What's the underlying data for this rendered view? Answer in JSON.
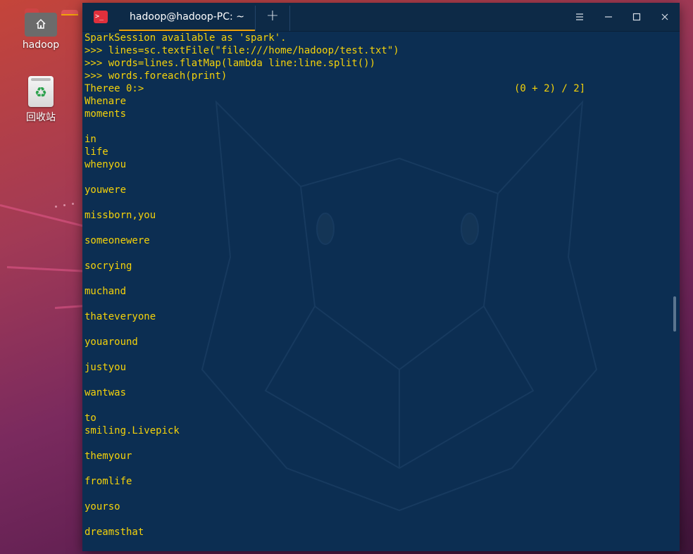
{
  "desktop": {
    "icons": [
      {
        "label": "hadoop",
        "icon": "home-folder-icon"
      },
      {
        "label": "回收站",
        "icon": "trash-icon"
      }
    ]
  },
  "terminal": {
    "tab_title": "hadoop@hadoop-PC: ~",
    "new_tab_symbol": "+",
    "window_buttons": {
      "menu": "☰",
      "minimize": "—",
      "maximize": "☐",
      "close": "✕"
    },
    "progress_text": "(0 + 2) / 2]",
    "lines": [
      "SparkSession available as 'spark'.",
      ">>> lines=sc.textFile(\"file:///home/hadoop/test.txt\")",
      ">>> words=lines.flatMap(lambda line:line.split())",
      ">>> words.foreach(print)",
      "Theree 0:>",
      "Whenare",
      "moments",
      "",
      "in",
      "life",
      "whenyou",
      "",
      "youwere",
      "",
      "missborn,you",
      "",
      "someonewere",
      "",
      "socrying",
      "",
      "muchand",
      "",
      "thateveryone",
      "",
      "youaround",
      "",
      "justyou",
      "",
      "wantwas",
      "",
      "to",
      "smiling.Livepick",
      "",
      "themyour",
      "",
      "fromlife",
      "",
      "yourso",
      "",
      "dreamsthat"
    ]
  },
  "colors": {
    "terminal_bg": "#0c2e52",
    "terminal_text": "#f5d20a",
    "tab_accent": "#f0a30a"
  }
}
